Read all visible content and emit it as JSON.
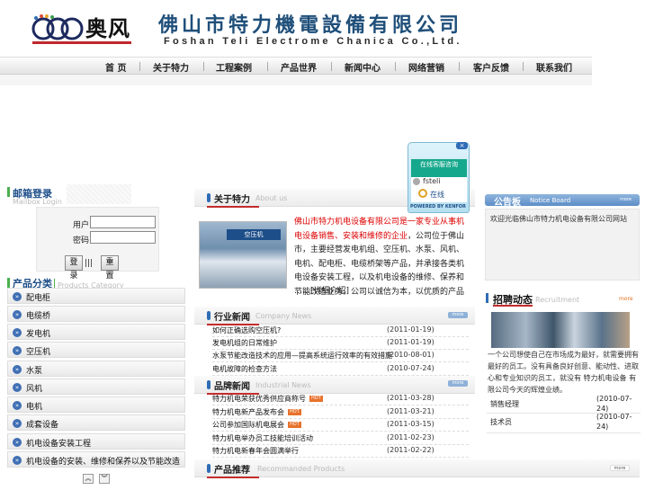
{
  "header": {
    "logo_text": "奥风",
    "company_cn": "佛山市特力機電設備有限公司",
    "company_en": "Foshan Teli Electrome Chanica Co.,Ltd."
  },
  "nav": [
    "首 页",
    "关于特力",
    "工程案例",
    "产品世界",
    "新闻中心",
    "网络营销",
    "客户反馈",
    "联系我们"
  ],
  "login": {
    "title": "邮箱登录",
    "subtitle": "Mailbox Login",
    "user_label": "用户:",
    "pass_label": "密码:",
    "login_btn": "登 录",
    "sep": "|||",
    "reset_btn": "重 置"
  },
  "products": {
    "title": "产品分类",
    "subtitle": "Products Category",
    "items": [
      "配电柜",
      "电缆桥",
      "发电机",
      "空压机",
      "水泵",
      "风机",
      "电机",
      "成套设备",
      "机电设备安装工程",
      "机电设备的安装、维修和保养以及节能改造…"
    ]
  },
  "about": {
    "title": "关于特力",
    "subtitle": "About us",
    "highlight": "佛山市特力机电设备有限公司是一家专业从事机电设备销售、安装和维修的企业",
    "body": "，公司位于佛山市，主要经营发电机组、空压机、水泵、风机、电机、配电柜、电缆桥架等产品，并承接各类机电设备安装工程，以及机电设备的维修、保养和节能改造业务。公司以诚信为本，以优质的产品和完善的服务赢得了广大客户的信赖与支持，欢迎各界朋友前来洽谈合作。",
    "more": "……[详细介绍]"
  },
  "industry_news": {
    "title": "行业新闻",
    "subtitle": "Company News",
    "more": "more",
    "rows": [
      {
        "title": "如何正确选购空压机?",
        "date": "(2011-01-19)"
      },
      {
        "title": "发电机组的日常维护",
        "date": "(2011-01-19)"
      },
      {
        "title": "水泵节能改造技术的应用—提高系统运行效率的有效措施",
        "date": "(2010-08-01)"
      },
      {
        "title": "电机故障的检查方法",
        "date": "(2010-07-24)"
      }
    ]
  },
  "brand_news": {
    "title": "品牌新闻",
    "subtitle": "Industrial News",
    "more": "more",
    "hot": "HOT",
    "rows": [
      {
        "title": "特力机电荣获优秀供应商称号",
        "date": "(2011-03-28)",
        "hot": true
      },
      {
        "title": "特力机电新产品发布会",
        "date": "(2011-03-21)",
        "hot": true
      },
      {
        "title": "公司参加国际机电展会",
        "date": "(2011-03-15)",
        "hot": true
      },
      {
        "title": "特力机电举办员工技能培训活动",
        "date": "(2011-02-23)",
        "hot": false
      },
      {
        "title": "特力机电新春年会圆满举行",
        "date": "(2011-02-22)",
        "hot": false
      }
    ]
  },
  "recommend": {
    "title": "产品推荐",
    "subtitle": "Recommanded Products",
    "more": "more"
  },
  "notice": {
    "title": "公告板",
    "subtitle": "Notice Board",
    "more": "more",
    "text": "欢迎光临佛山市特力机电设备有限公司网站"
  },
  "recruit": {
    "title": "招聘动态",
    "subtitle": "Recruitment",
    "more": "more",
    "text": "一个公司想使自己在市场成为最好，就需要拥有最好的员工。没有具备良好创意、能动性、进取心和专业知识的员工，就没有 特力机电设备 有限公司今天的辉煌业绩。",
    "jobs": [
      {
        "title": "销售经理",
        "date": "(2010-07-24)"
      },
      {
        "title": "技术员",
        "date": "(2010-07-24)"
      }
    ]
  },
  "chat_popup": {
    "header": "在线客服咨询",
    "user": "fsteli",
    "online": "在线",
    "powered": "POWERED BY KENFOR"
  }
}
